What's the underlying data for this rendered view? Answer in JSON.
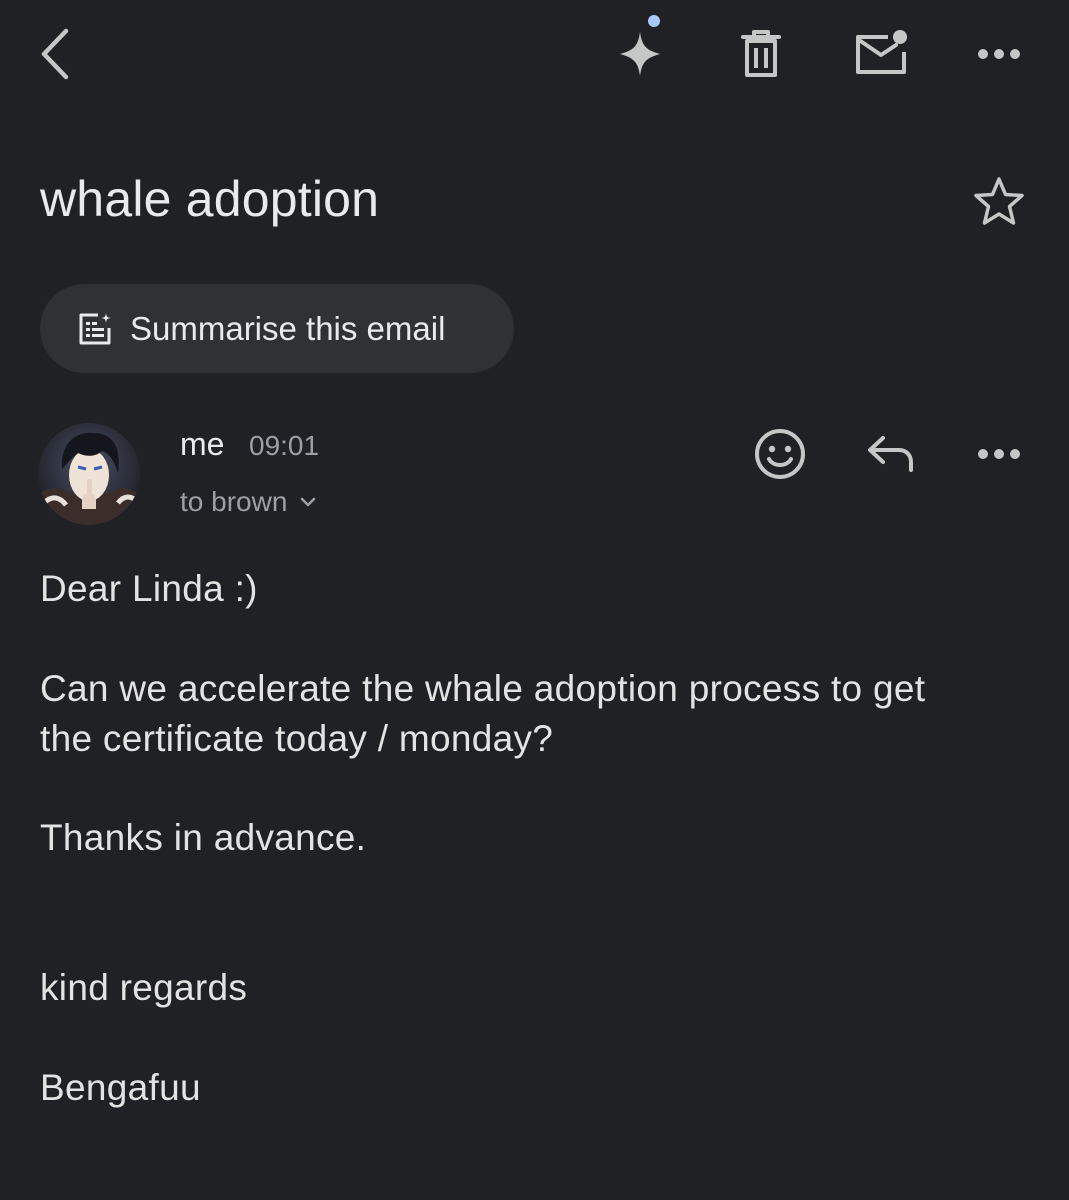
{
  "toolbar": {
    "back_icon": "chevron-left-icon",
    "ai_icon": "sparkle-icon",
    "delete_icon": "trash-icon",
    "mark_unread_icon": "mail-unread-icon",
    "more_icon": "more-horizontal-icon"
  },
  "email": {
    "subject": "whale adoption",
    "star_icon": "star-outline-icon"
  },
  "summarise_button": {
    "label": "Summarise this email",
    "icon": "summarise-icon"
  },
  "message": {
    "sender": "me",
    "time": "09:01",
    "recipient": "to brown",
    "actions": {
      "emoji_icon": "emoji-icon",
      "reply_icon": "reply-icon",
      "more_icon": "more-horizontal-icon"
    },
    "body": {
      "line1": "Dear Linda :)",
      "line2": "Can we accelerate the whale adoption process to get",
      "line3": "the certificate today / monday?",
      "line4": "Thanks in advance.",
      "line5": "kind regards",
      "line6": "Bengafuu"
    }
  },
  "colors": {
    "background": "#202124",
    "text": "#e3e3e3",
    "secondary_text": "#9aa0a6",
    "icon": "#c4c7c5",
    "button_background": "#303134",
    "accent_dot": "#a8c7fa"
  }
}
